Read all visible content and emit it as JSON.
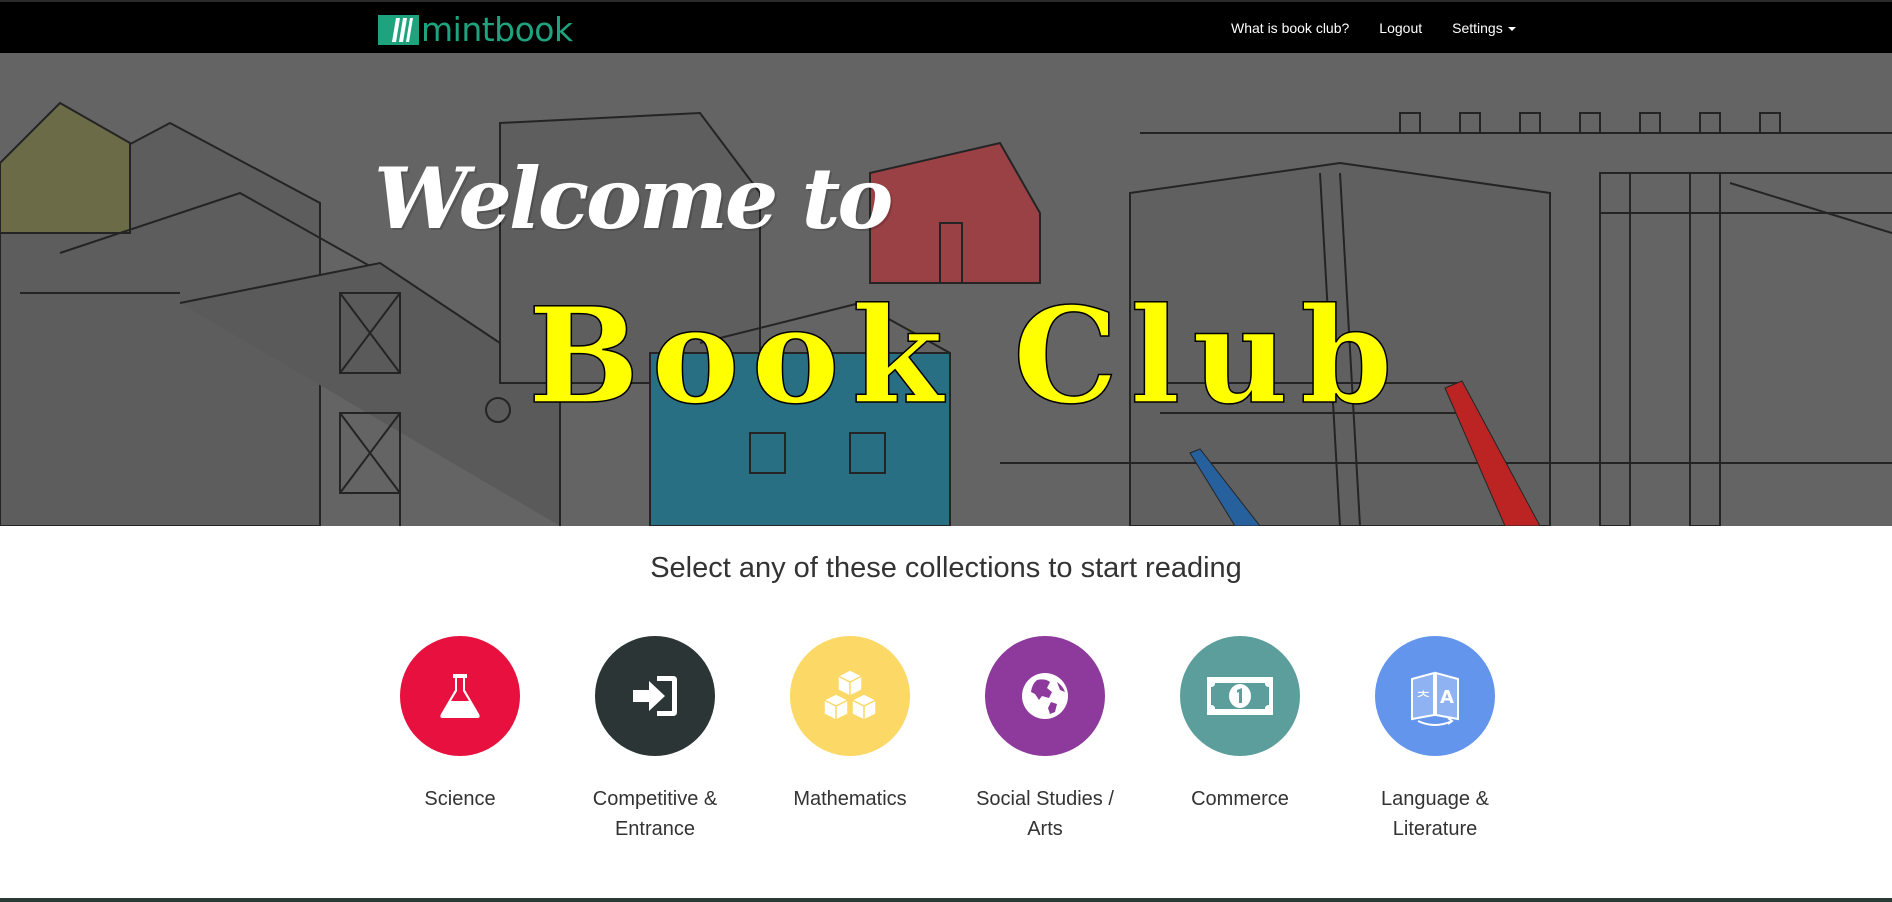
{
  "navbar": {
    "brand": "mintbook",
    "links": {
      "what_is": "What is book club?",
      "logout": "Logout",
      "settings": "Settings"
    }
  },
  "hero": {
    "welcome": "Welcome to",
    "title": "Book Club"
  },
  "main": {
    "tagline": "Select any of these collections to start reading",
    "collections": [
      {
        "label": "Science",
        "icon": "flask-icon",
        "color": "#e8103f"
      },
      {
        "label": "Competitive & Entrance",
        "icon": "sign-in-icon",
        "color": "#2b3536"
      },
      {
        "label": "Mathematics",
        "icon": "cubes-icon",
        "color": "#fcd867"
      },
      {
        "label": "Social Studies / Arts",
        "icon": "globe-icon",
        "color": "#8e3a9c"
      },
      {
        "label": "Commerce",
        "icon": "money-icon",
        "color": "#5b9e9c"
      },
      {
        "label": "Language & Literature",
        "icon": "translate-icon",
        "color": "#6495ed"
      }
    ]
  },
  "colors": {
    "brand": "#1fa37f",
    "navbar_bg": "#000000",
    "title_yellow": "#ffff00"
  }
}
